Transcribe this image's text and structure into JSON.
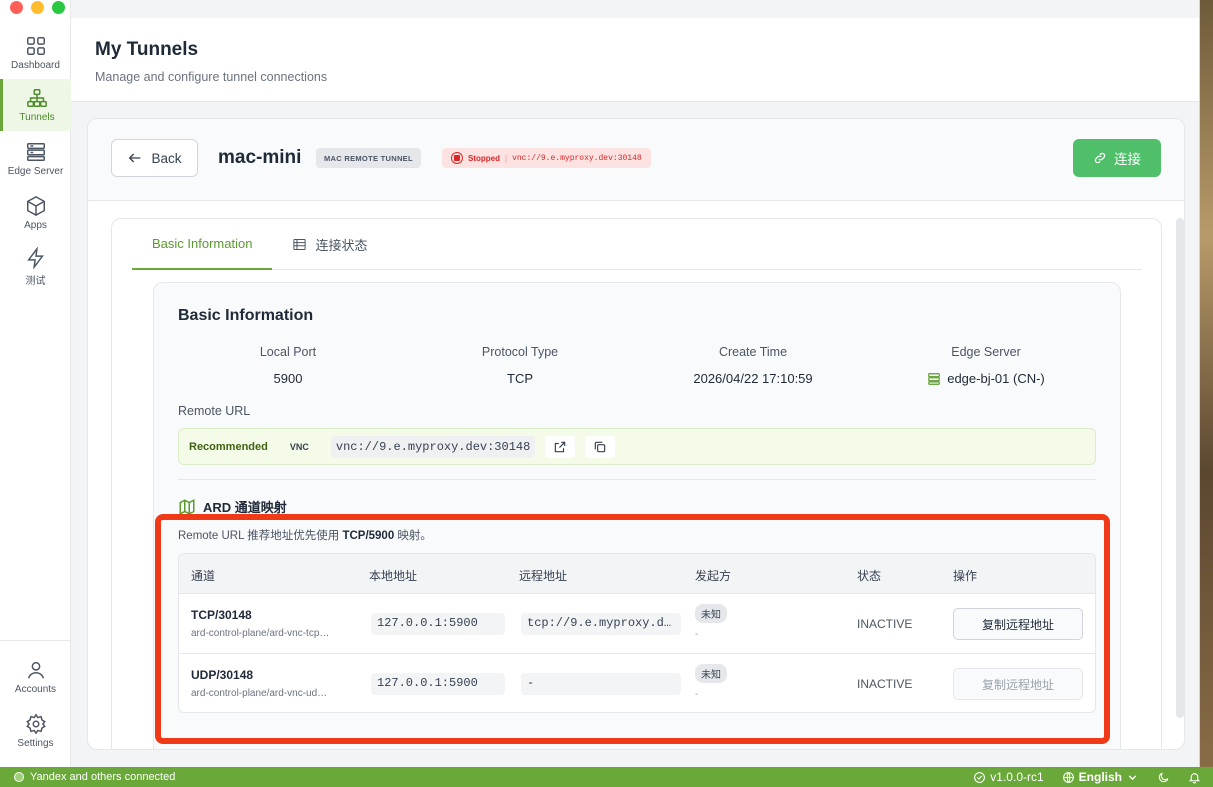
{
  "sidebar": {
    "items": [
      {
        "label": "Dashboard",
        "icon": "grid-icon"
      },
      {
        "label": "Tunnels",
        "icon": "network-icon",
        "active": true
      },
      {
        "label": "Edge Server",
        "icon": "server-icon"
      },
      {
        "label": "Apps",
        "icon": "cube-icon"
      },
      {
        "label": "测试",
        "icon": "bolt-icon"
      }
    ],
    "bottom": [
      {
        "label": "Accounts",
        "icon": "user-icon"
      },
      {
        "label": "Settings",
        "icon": "gear-icon"
      }
    ]
  },
  "header": {
    "title": "My Tunnels",
    "subtitle": "Manage and configure tunnel connections"
  },
  "tunnel": {
    "back_label": "Back",
    "name": "mac-mini",
    "type_badge": "MAC REMOTE TUNNEL",
    "status": "Stopped",
    "status_sep": "|",
    "status_url": "vnc://9.e.myproxy.dev:30148",
    "connect_label": "连接"
  },
  "tabs": [
    {
      "label": "Basic Information",
      "active": true
    },
    {
      "label": "连接状态",
      "icon": "list-icon"
    }
  ],
  "basic": {
    "title": "Basic Information",
    "fields": [
      {
        "label": "Local Port",
        "value": "5900"
      },
      {
        "label": "Protocol Type",
        "value": "TCP"
      },
      {
        "label": "Create Time",
        "value": "2026/04/22 17:10:59"
      },
      {
        "label": "Edge Server",
        "value": "edge-bj-01 (CN-)"
      }
    ],
    "remote_url_label": "Remote URL",
    "recommended": "Recommended",
    "protocol_tag": "VNC",
    "remote_url": "vnc://9.e.myproxy.dev:30148"
  },
  "ard": {
    "title": "ARD 通道映射",
    "note_prefix": "Remote URL 推荐地址优先使用 ",
    "note_bold": "TCP/5900",
    "note_suffix": " 映射。",
    "columns": [
      "通道",
      "本地地址",
      "远程地址",
      "发起方",
      "状态",
      "操作"
    ],
    "rows": [
      {
        "channel": "TCP/30148",
        "sub": "ard-control-plane/ard-vnc-tcp…",
        "local": "127.0.0.1:5900",
        "remote": "tcp://9.e.myproxy.d…",
        "initiator": "未知",
        "initiator_sub": "-",
        "state": "INACTIVE",
        "action": "复制远程地址",
        "action_enabled": true
      },
      {
        "channel": "UDP/30148",
        "sub": "ard-control-plane/ard-vnc-ud…",
        "local": "127.0.0.1:5900",
        "remote": "-",
        "initiator": "未知",
        "initiator_sub": "-",
        "state": "INACTIVE",
        "action": "复制远程地址",
        "action_enabled": false
      }
    ]
  },
  "statusbar": {
    "left": "Yandex and others connected",
    "version": "v1.0.0-rc1",
    "language": "English"
  },
  "colors": {
    "accent": "#6aa83a",
    "connect": "#4fbf6a",
    "stopped": "#dc2626",
    "annotation": "#f03a17"
  }
}
